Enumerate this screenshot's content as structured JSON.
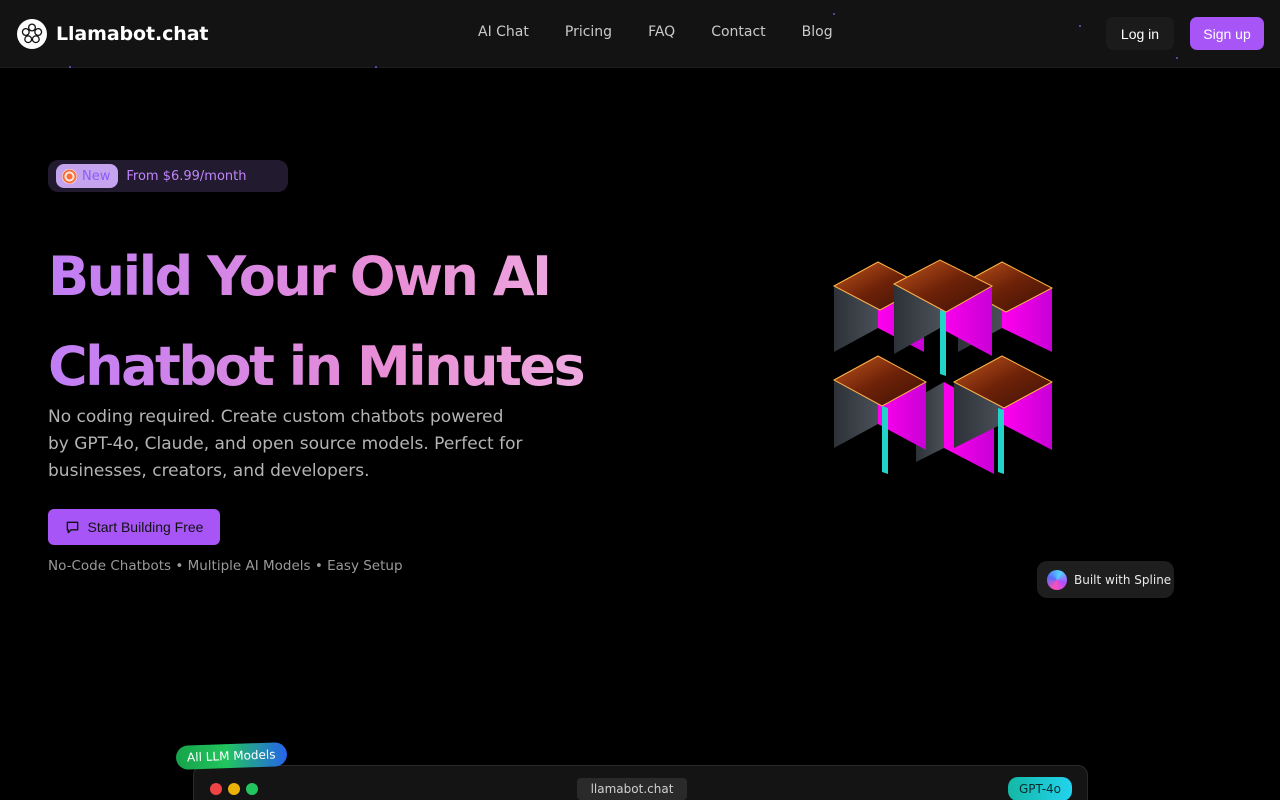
{
  "brand": {
    "name": "Llamabot.chat",
    "logo_icon": "flower-logo-icon"
  },
  "nav": {
    "links": [
      "AI Chat",
      "Pricing",
      "FAQ",
      "Contact",
      "Blog"
    ],
    "login_label": "Log in",
    "signup_label": "Sign up"
  },
  "hero": {
    "badge": {
      "new_label": "New",
      "new_icon": "target-icon",
      "price_text": "From $6.99/month"
    },
    "title_line1": "Build Your Own AI",
    "title_line2": "Chatbot in Minutes",
    "description": "No coding required. Create custom chatbots powered by GPT-4o, Claude, and open source models. Perfect for businesses, creators, and developers.",
    "cta_label": "Start Building Free",
    "cta_icon": "chat-bubble-icon",
    "features": "No-Code Chatbots • Multiple AI Models • Easy Setup"
  },
  "spline_badge": {
    "label": "Built with Spline",
    "icon": "spline-logo-icon"
  },
  "preview": {
    "tag_label": "All LLM Models",
    "url": "llamabot.chat",
    "model_label": "GPT-4o",
    "window_dots": [
      "#ef4444",
      "#eab308",
      "#22c55e"
    ]
  },
  "colors": {
    "accent": "#a855f7",
    "background": "#000000",
    "nav_bg": "#131313"
  }
}
